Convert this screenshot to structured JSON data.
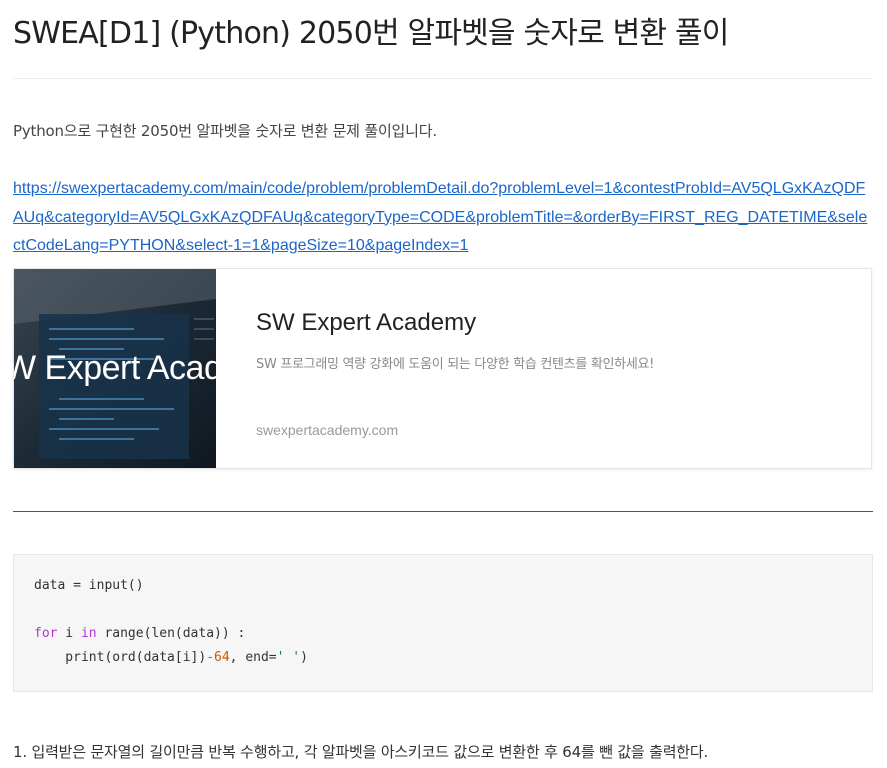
{
  "post": {
    "title": "SWEA[D1] (Python) 2050번 알파벳을 숫자로 변환 풀이",
    "intro": "Python으로 구현한 2050번 알파벳을 숫자로 변환 문제 풀이입니다.",
    "link": "https://swexpertacademy.com/main/code/problem/problemDetail.do?problemLevel=1&contestProbId=AV5QLGxKAzQDFAUq&categoryId=AV5QLGxKAzQDFAUq&categoryType=CODE&problemTitle=&orderBy=FIRST_REG_DATETIME&selectCodeLang=PYTHON&select-1=1&pageSize=10&pageIndex=1"
  },
  "link_card": {
    "thumbnail_text": "W Expert Acade",
    "title": "SW Expert Academy",
    "description": "SW 프로그래밍 역량 강화에 도움이 되는 다양한 학습 컨텐츠를 확인하세요!",
    "domain": "swexpertacademy.com"
  },
  "code": {
    "line1": "data = input()",
    "line2_kw1": "for",
    "line2_mid": " i ",
    "line2_kw2": "in",
    "line2_rest": " range(len(data)) :",
    "line3_a": "    print(ord(data[i])",
    "line3_num": "-64",
    "line3_b": ", end=",
    "line3_str": "' '",
    "line3_c": ")"
  },
  "steps": [
    "1. 입력받은 문자열의 길이만큼 반복 수행하고, 각 알파벳을 아스키코드 값으로 변환한 후 64를 뺀 값을 출력한다."
  ]
}
